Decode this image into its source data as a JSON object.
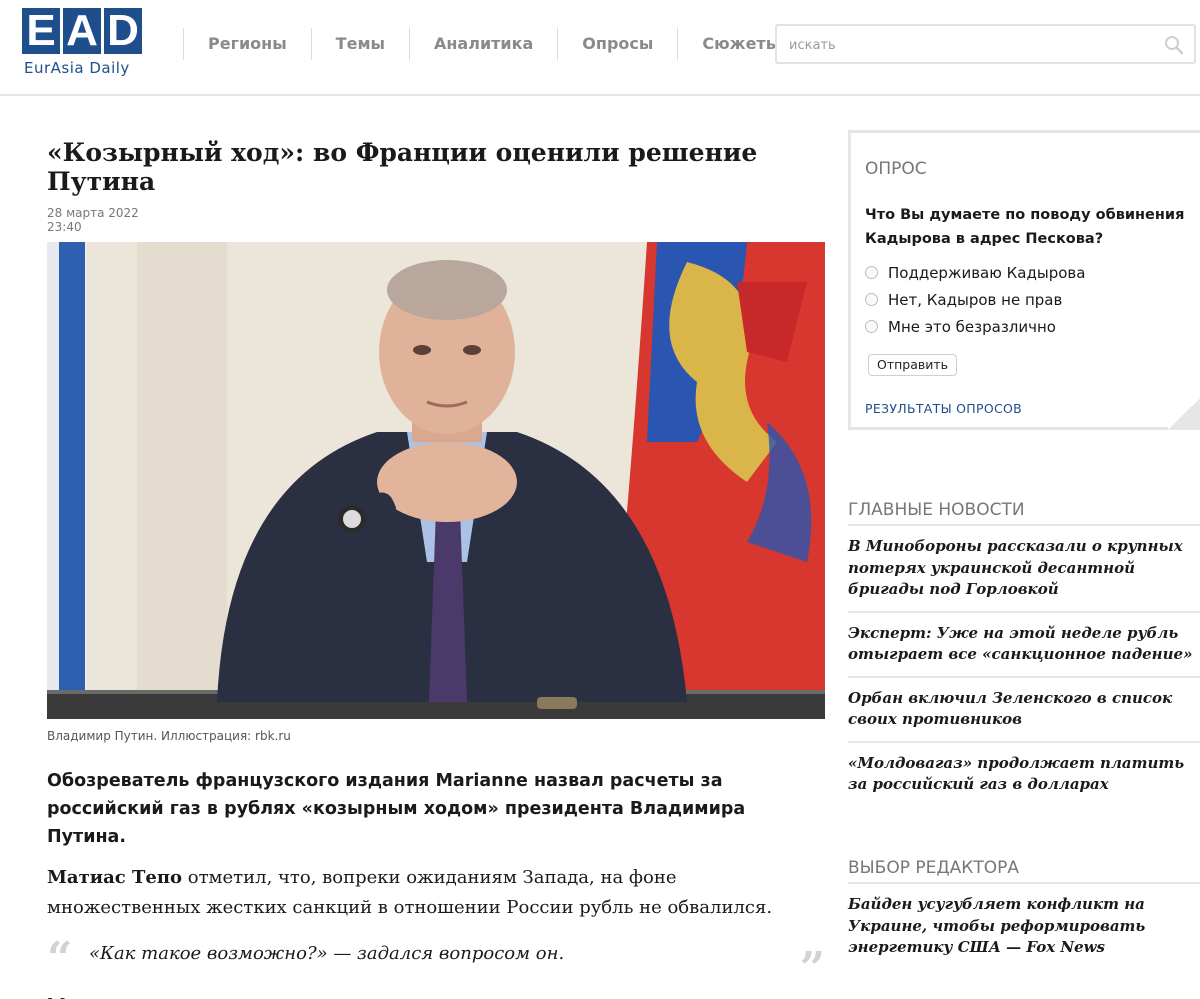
{
  "header": {
    "logo_letters": [
      "E",
      "A",
      "D"
    ],
    "logo_subtitle": "EurAsia Daily",
    "nav": [
      "Регионы",
      "Темы",
      "Аналитика",
      "Опросы",
      "Сюжеты"
    ],
    "search_placeholder": "искать"
  },
  "article": {
    "title": "«Козырный ход»: во Франции оценили решение Путина",
    "date": "28 марта 2022",
    "time": "23:40",
    "caption": "Владимир Путин. Иллюстрация: rbk.ru",
    "lead": "Обозреватель французского издания Marianne назвал расчеты за российский газ в рублях «козырным ходом» президента Владимира Путина.",
    "para1_name": "Матиас Тепо",
    "para1_rest": " отметил, что, вопреки ожиданиям Запада, на фоне множественных жестких санкций в отношении России рубль не обвалился.",
    "quote": "«Как такое возможно?» — задался вопросом он.",
    "para2": "Москва ввела контроль за потоками капиталов, предотвратив вывод валюты"
  },
  "poll": {
    "label": "ОПРОС",
    "question": "Что Вы думаете по поводу обвинения Кадырова в адрес Пескова?",
    "options": [
      "Поддерживаю Кадырова",
      "Нет, Кадыров не прав",
      "Мне это безразлично"
    ],
    "submit": "Отправить",
    "results": "РЕЗУЛЬТАТЫ ОПРОСОВ"
  },
  "main_news": {
    "heading": "ГЛАВНЫЕ НОВОСТИ",
    "items": [
      "В Минобороны рассказали о крупных потерях украинской десантной бригады под Горловкой",
      "Эксперт: Уже на этой неделе рубль отыграет все «санкционное падение»",
      "Орбан включил Зеленского в список своих противников",
      "«Молдовагаз» продолжает платить за российский газ в долларах"
    ]
  },
  "editor_choice": {
    "heading": "ВЫБОР РЕДАКТОРА",
    "items": [
      "Байден усугубляет конфликт на Украине, чтобы реформировать энергетику США — Fox News"
    ]
  },
  "colors": {
    "brand": "#1f4e8c",
    "muted": "#777777",
    "divider": "#e6e6e6"
  }
}
